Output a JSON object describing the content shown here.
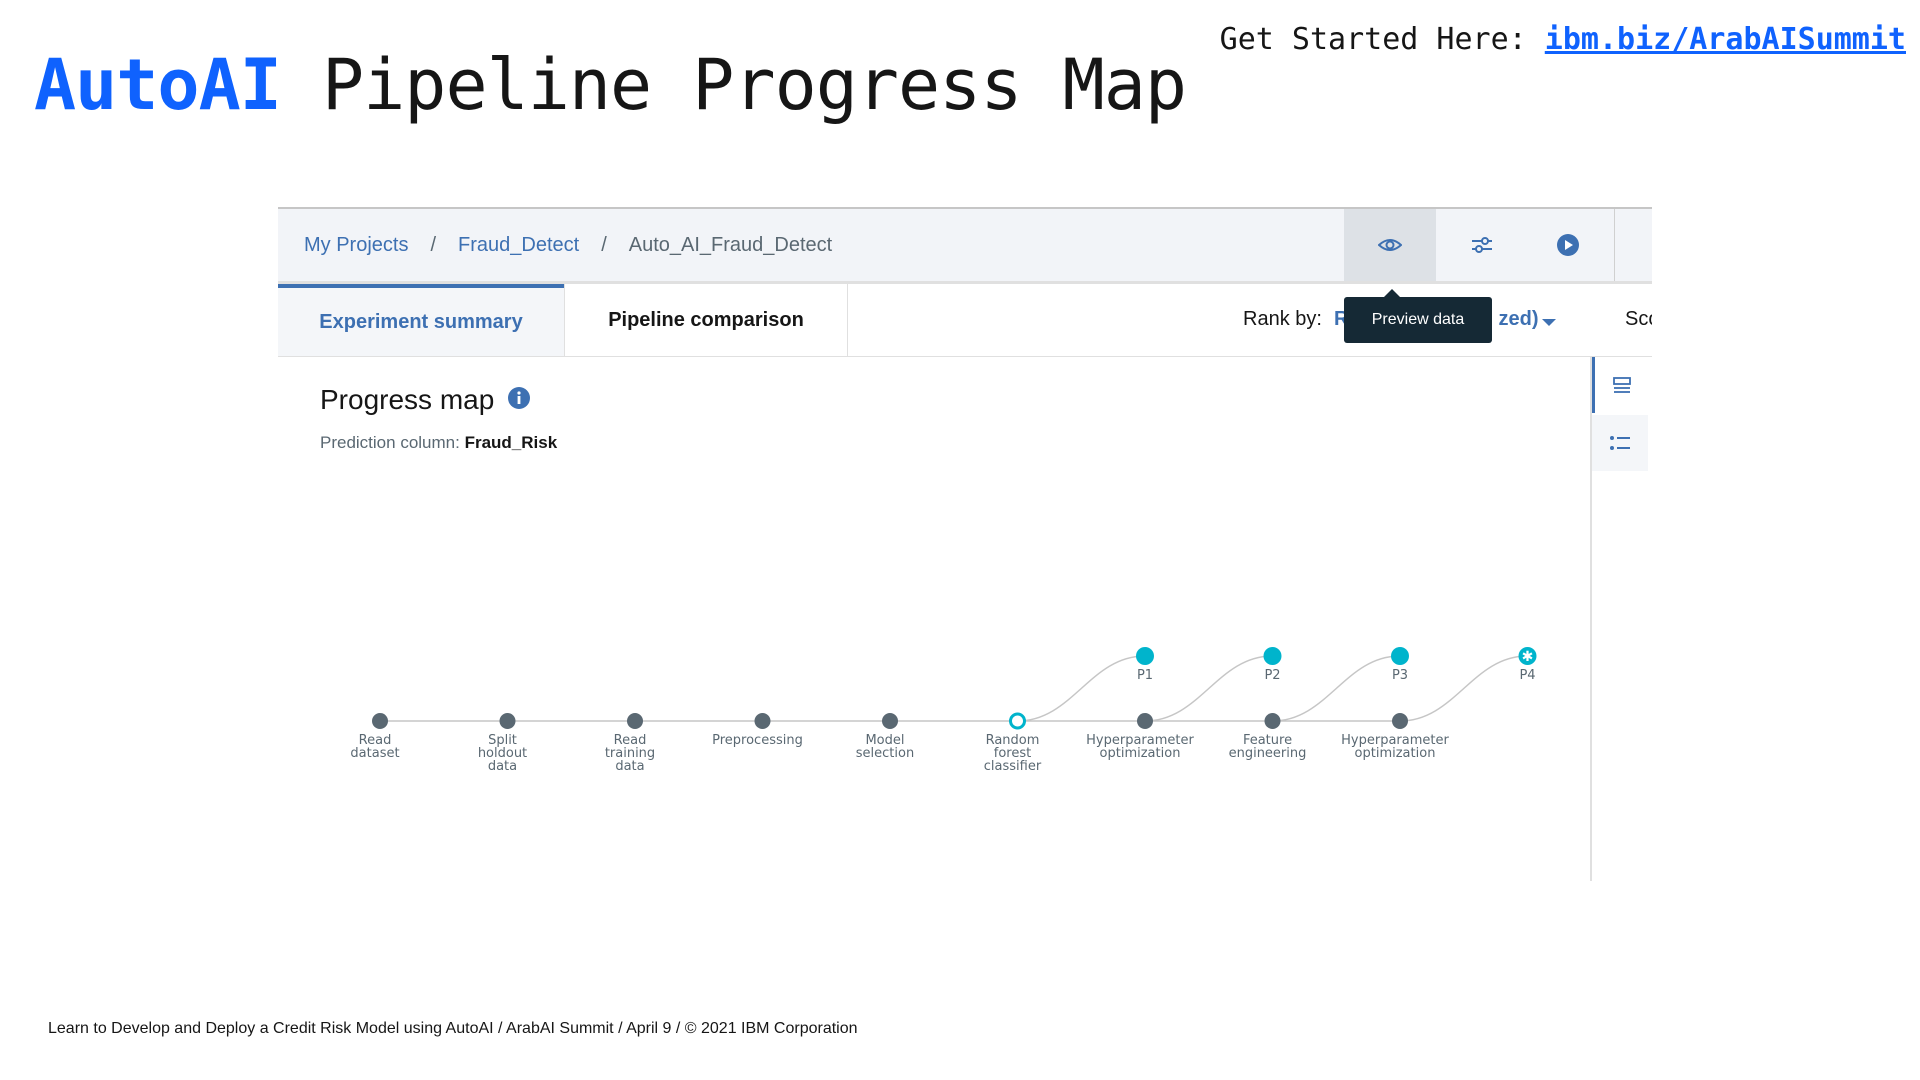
{
  "slide": {
    "title_accent": "AutoAI",
    "title_rest": " Pipeline Progress Map",
    "get_started_label": "Get Started Here: ",
    "get_started_link": "ibm.biz/ArabAISummit",
    "footer": "Learn to Develop and Deploy a Credit Risk Model using AutoAI / ArabAI Summit / April 9 / © 2021 IBM Corporation"
  },
  "app": {
    "breadcrumb": [
      "My Projects",
      "Fraud_Detect",
      "Auto_AI_Fraud_Detect"
    ],
    "breadcrumb_sep": "/",
    "toolbar": {
      "preview_icon": "eye-icon",
      "settings_icon": "sliders-icon",
      "run_icon": "play-icon",
      "tooltip": "Preview data"
    },
    "tabs": [
      "Experiment summary",
      "Pipeline comparison"
    ],
    "rank_by_label": "Rank by:",
    "rank_by_value": "R                           zed)",
    "score_label": "Score",
    "side_icons": [
      "list-view-icon",
      "bullet-list-icon"
    ],
    "progress_map": {
      "title": "Progress map",
      "info_icon": "info-icon",
      "prediction_label": "Prediction column: ",
      "prediction_value": "Fraud_Risk",
      "stages": [
        [
          "Read",
          "dataset"
        ],
        [
          "Split",
          "holdout",
          "data"
        ],
        [
          "Read",
          "training",
          "data"
        ],
        [
          "Preprocessing"
        ],
        [
          "Model",
          "selection"
        ],
        [
          "Random",
          "forest",
          "classifier"
        ],
        [
          "Hyperparameter",
          "optimization"
        ],
        [
          "Feature",
          "engineering"
        ],
        [
          "Hyperparameter",
          "optimization"
        ]
      ],
      "pipelines": [
        "P1",
        "P2",
        "P3",
        "P4"
      ]
    },
    "colors": {
      "accent": "#0f62fe",
      "link_blue": "#3d70b2",
      "stage_node": "#5a6872",
      "pipeline_node": "#00b4cc",
      "tooltip_bg": "#152935"
    }
  }
}
